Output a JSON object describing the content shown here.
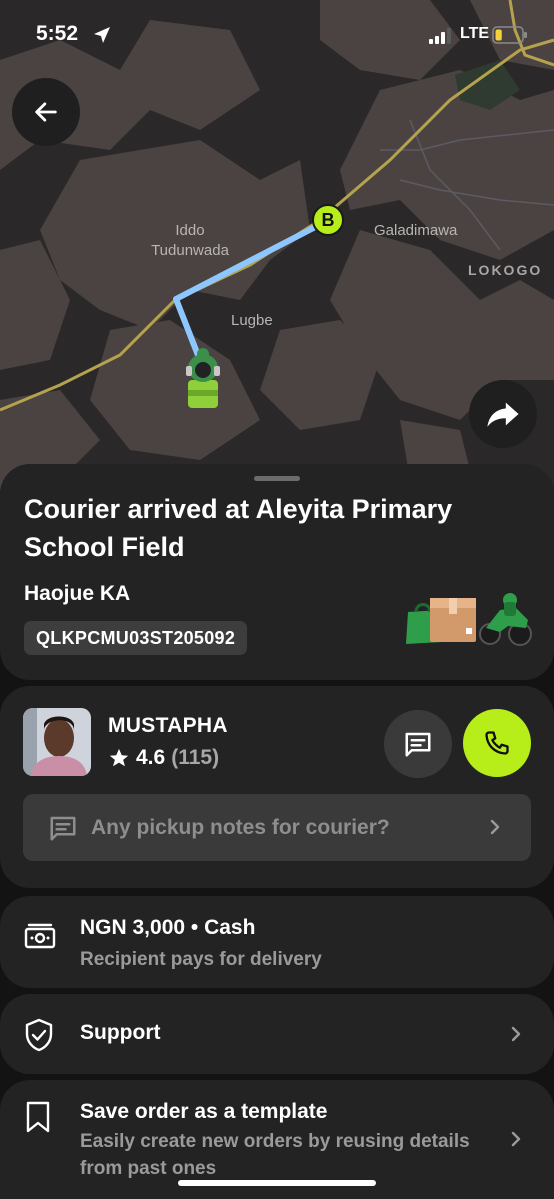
{
  "status_bar": {
    "time": "5:52",
    "network": "LTE",
    "battery_level": 0.25
  },
  "map": {
    "labels": {
      "iddo": "Iddo\nTudunwada",
      "galadimawa": "Galadimawa",
      "lokogo": "LOKOGO",
      "lugbe": "Lugbe"
    },
    "destination_marker": "B",
    "route_color": "#8ec6ff",
    "accent_color": "#b7ee1a"
  },
  "order_status": {
    "title": "Courier arrived at Aleyita Primary School Field",
    "vehicle": "Haojue KA",
    "plate": "QLKPCMU03ST205092"
  },
  "courier": {
    "name": "MUSTAPHA",
    "rating": "4.6",
    "rating_count": "(115)",
    "notes_placeholder": "Any pickup notes for courier?"
  },
  "payment": {
    "title": "NGN 3,000 • Cash",
    "subtitle": "Recipient pays for delivery"
  },
  "support": {
    "title": "Support"
  },
  "template": {
    "title": "Save order as a template",
    "subtitle": "Easily create new orders by reusing details from past ones"
  },
  "icons": {
    "back": "arrow-left-icon",
    "share": "share-arrow-icon",
    "chat": "chat-icon",
    "call": "phone-icon",
    "notes": "note-icon",
    "payment": "cash-icon",
    "support": "shield-check-icon",
    "template": "bookmark-icon"
  }
}
